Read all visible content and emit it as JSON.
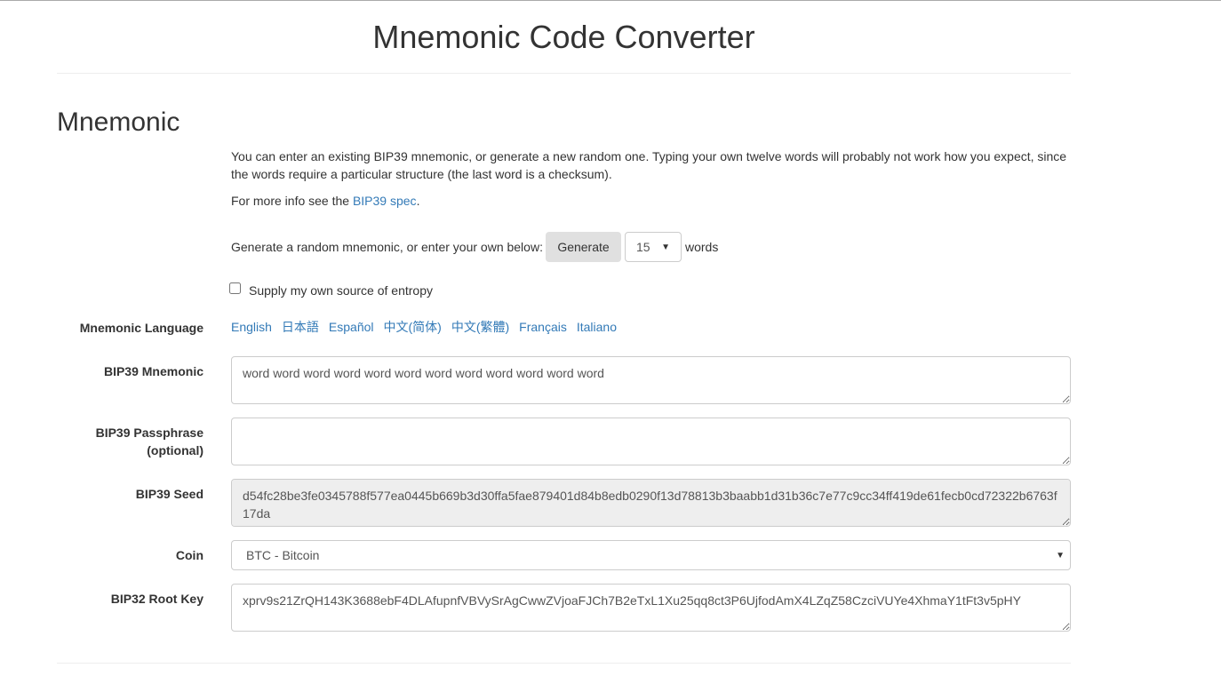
{
  "title": "Mnemonic Code Converter",
  "section": "Mnemonic",
  "intro": "You can enter an existing BIP39 mnemonic, or generate a new random one. Typing your own twelve words will probably not work how you expect, since the words require a particular structure (the last word is a checksum).",
  "more_info_prefix": "For more info see the ",
  "more_info_link": "BIP39 spec",
  "more_info_suffix": ".",
  "generate_prompt": "Generate a random mnemonic, or enter your own below:",
  "generate_label": "Generate",
  "word_count": "15",
  "words_label": "words",
  "entropy_label": "Supply my own source of entropy",
  "language_label": "Mnemonic Language",
  "languages": [
    "English",
    "日本語",
    "Español",
    "中文(简体)",
    "中文(繁體)",
    "Français",
    "Italiano"
  ],
  "mnemonic_label": "BIP39 Mnemonic",
  "mnemonic_value": "word word word word word word word word word word word word",
  "passphrase_label": "BIP39 Passphrase (optional)",
  "passphrase_value": "",
  "seed_label": "BIP39 Seed",
  "seed_value": "d54fc28be3fe0345788f577ea0445b669b3d30ffa5fae879401d84b8edb0290f13d78813b3baabb1d31b36c7e77c9cc34ff419de61fecb0cd72322b6763f17da",
  "coin_label": "Coin",
  "coin_value": "BTC - Bitcoin",
  "root_key_label": "BIP32 Root Key",
  "root_key_value": "xprv9s21ZrQH143K3688ebF4DLAfupnfVBVySrAgCwwZVjoaFJCh7B2eTxL1Xu25qq8ct3P6UjfodAmX4LZqZ58CzciVUYe4XhmaY1tFt3v5pHY"
}
